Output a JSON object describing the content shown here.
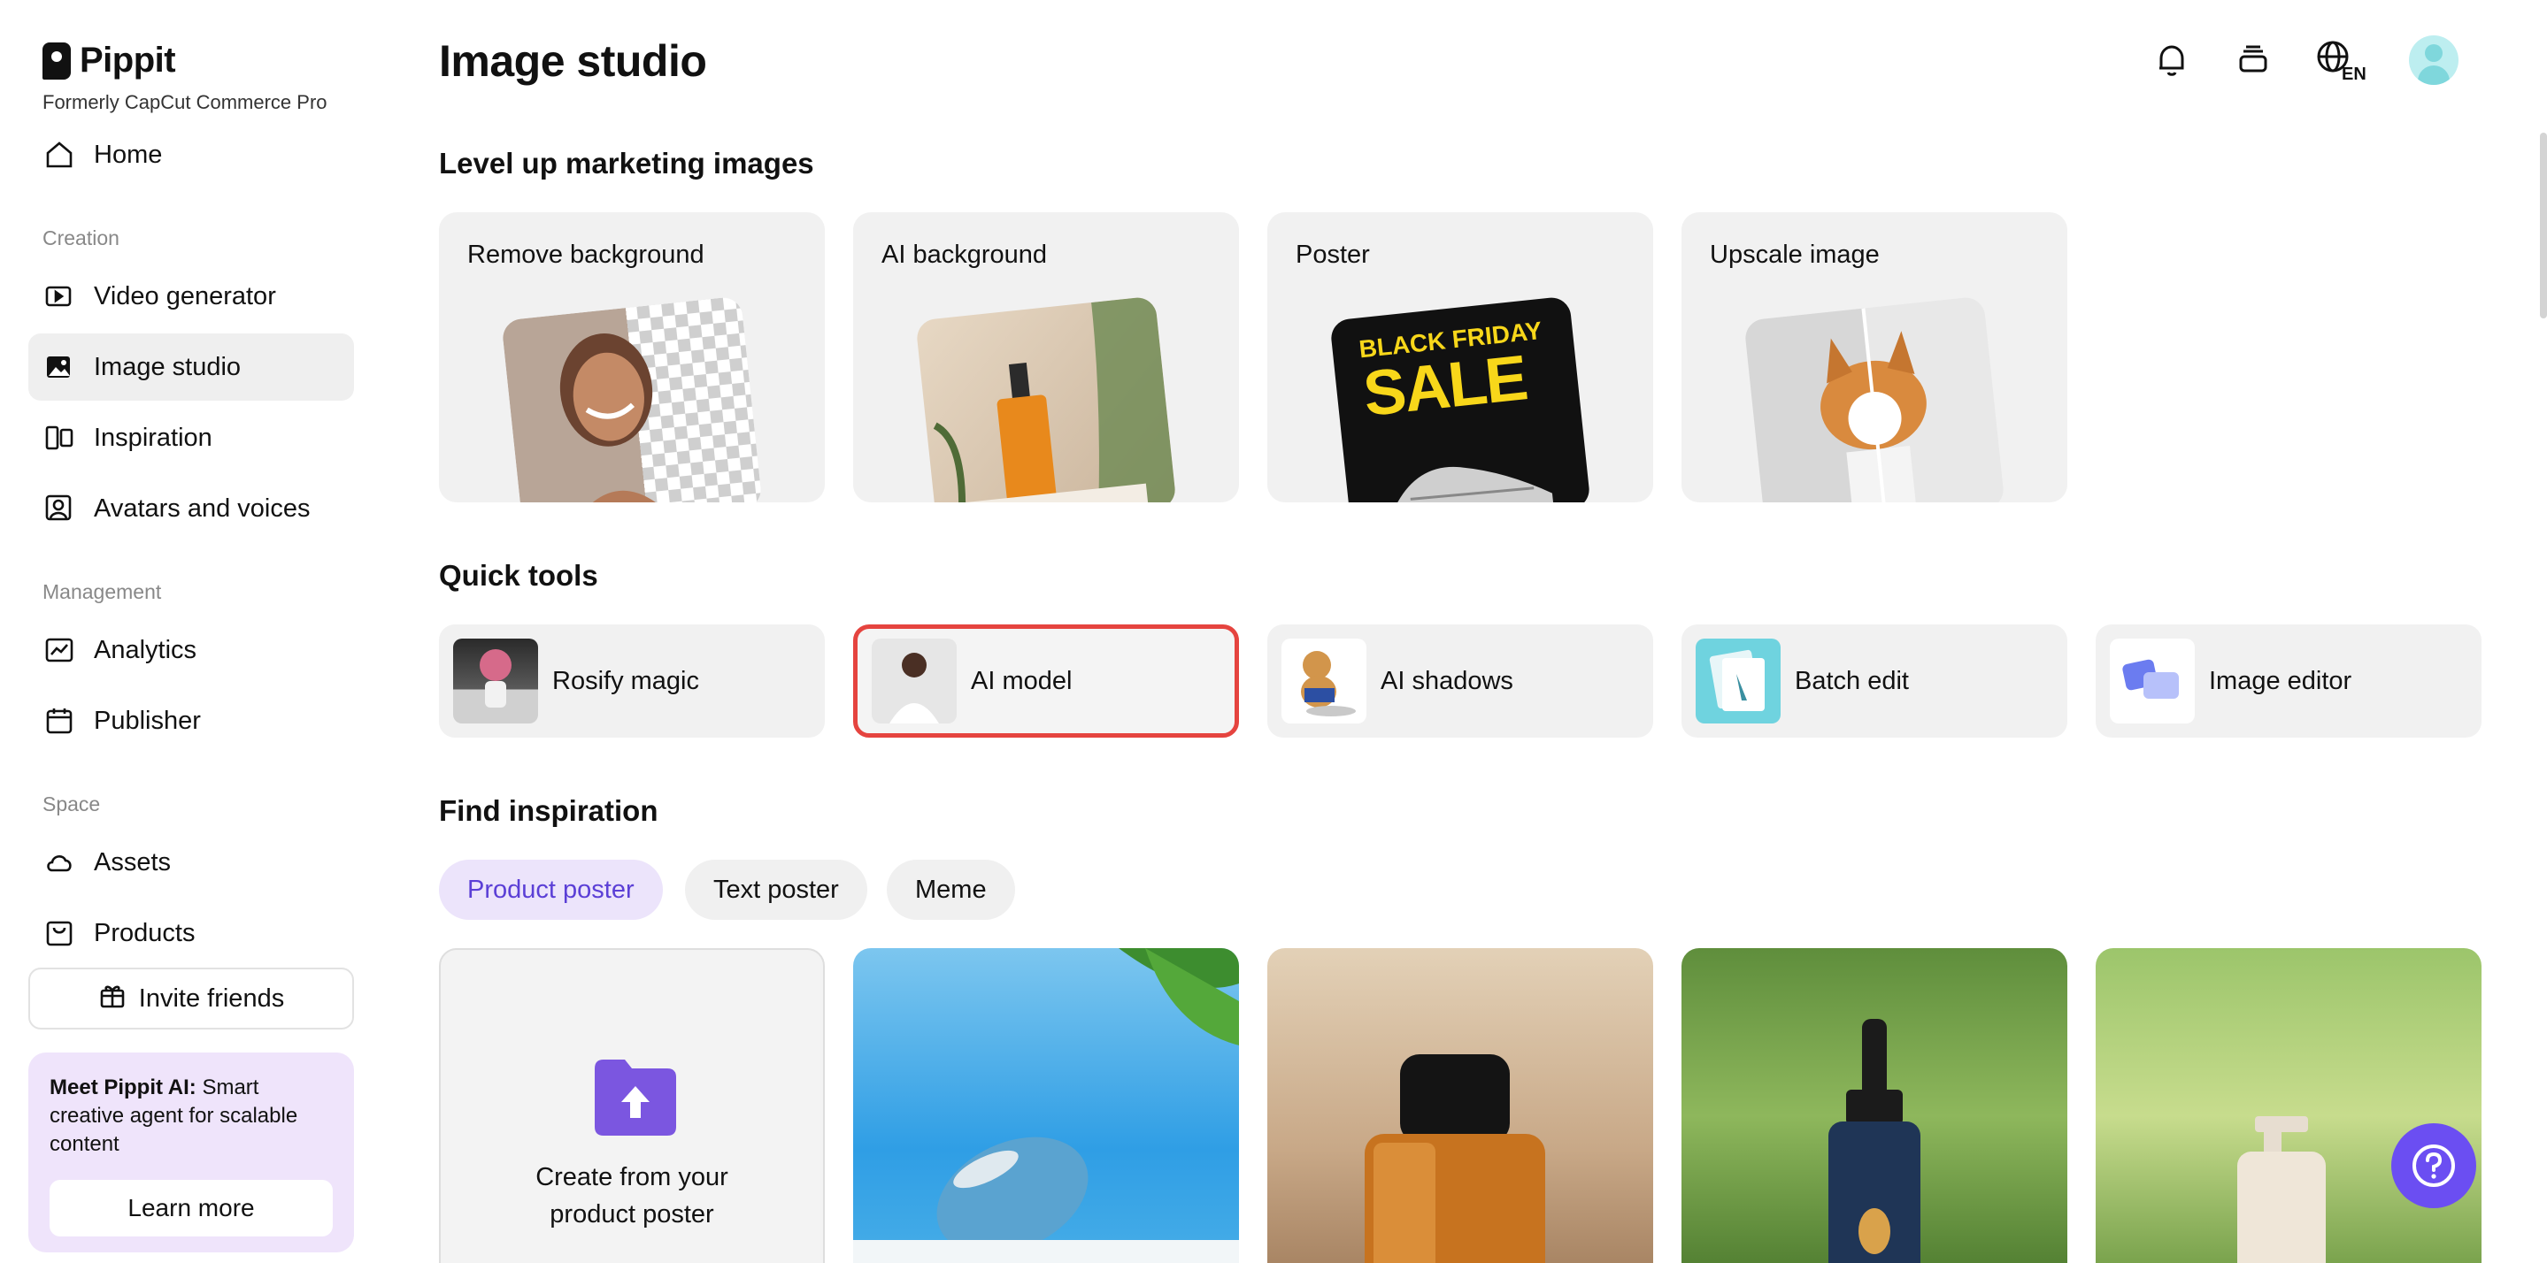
{
  "brand": {
    "name": "Pippit",
    "subtitle": "Formerly CapCut Commerce Pro"
  },
  "sidebar": {
    "home": "Home",
    "sections": {
      "creation": "Creation",
      "management": "Management",
      "space": "Space"
    },
    "items": [
      {
        "label": "Video generator"
      },
      {
        "label": "Image studio"
      },
      {
        "label": "Inspiration"
      },
      {
        "label": "Avatars and voices"
      },
      {
        "label": "Analytics"
      },
      {
        "label": "Publisher"
      },
      {
        "label": "Assets"
      },
      {
        "label": "Products"
      }
    ],
    "invite": "Invite friends",
    "promo": {
      "bold": "Meet Pippit AI:",
      "text": " Smart creative agent for scalable content",
      "button": "Learn more"
    }
  },
  "header": {
    "title": "Image studio",
    "lang": "EN"
  },
  "marketing": {
    "title": "Level up marketing images",
    "cards": [
      {
        "label": "Remove background"
      },
      {
        "label": "AI background"
      },
      {
        "label": "Poster",
        "poster_text_1": "BLACK FRIDAY",
        "poster_text_2": "SALE"
      },
      {
        "label": "Upscale image"
      }
    ]
  },
  "quick_tools": {
    "title": "Quick tools",
    "items": [
      {
        "label": "Rosify magic"
      },
      {
        "label": "AI model"
      },
      {
        "label": "AI shadows"
      },
      {
        "label": "Batch edit"
      },
      {
        "label": "Image editor"
      }
    ]
  },
  "inspiration": {
    "title": "Find inspiration",
    "chips": [
      {
        "label": "Product poster",
        "active": true
      },
      {
        "label": "Text poster"
      },
      {
        "label": "Meme"
      }
    ],
    "create": {
      "line1": "Create from your",
      "line2": "product poster"
    }
  },
  "colors": {
    "accent": "#6b4ef2",
    "highlight": "#e5443f",
    "chip_active_bg": "#ece4fb"
  }
}
